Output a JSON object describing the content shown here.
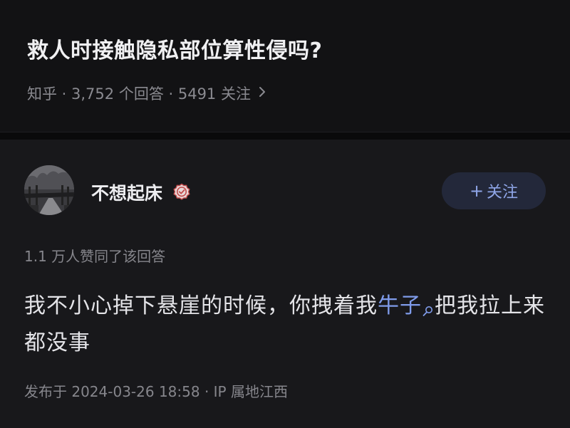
{
  "question": {
    "title": "救人时接触隐私部位算性侵吗?",
    "meta": "知乎 · 3,752 个回答 · 5491 关注",
    "chevron_icon": "chevron-right-icon"
  },
  "answer": {
    "author": {
      "name": "不想起床",
      "avatar_icon": "avatar",
      "badge_icon": "verified-badge-icon"
    },
    "follow_button": {
      "plus": "+",
      "label": "关注"
    },
    "upvote_summary": "1.1 万人赞同了该回答",
    "content": {
      "part1": "我不小心掉下悬崖的时候，你拽着我",
      "link_term": "牛子",
      "part2": "把我拉上来都没事"
    },
    "publish_info": "发布于 2024-03-26 18:58 · IP 属地江西"
  },
  "colors": {
    "background": "#121214",
    "card": "#18181b",
    "link": "#7f9bea",
    "follow_bg": "#23283a"
  }
}
